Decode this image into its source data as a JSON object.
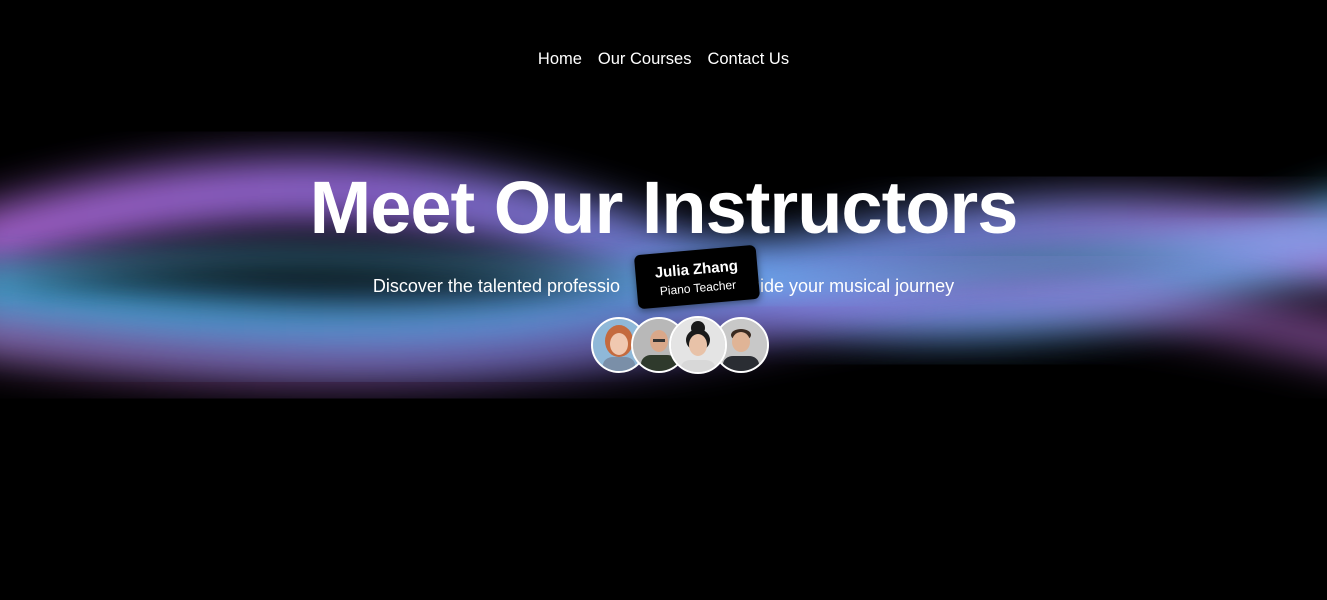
{
  "nav": {
    "items": [
      {
        "label": "Home"
      },
      {
        "label": "Our Courses"
      },
      {
        "label": "Contact Us"
      }
    ]
  },
  "hero": {
    "title": "Meet Our Instructors",
    "subtitle_before": "Discover the talented professio",
    "subtitle_after": "uide your musical journey"
  },
  "tooltip": {
    "name": "Julia Zhang",
    "role": "Piano Teacher"
  },
  "colors": {
    "background": "#000000",
    "wave_cyan": "#3fb6e0",
    "wave_violet": "#a66be0",
    "wave_pink": "#d86fd8",
    "text": "#ffffff"
  }
}
